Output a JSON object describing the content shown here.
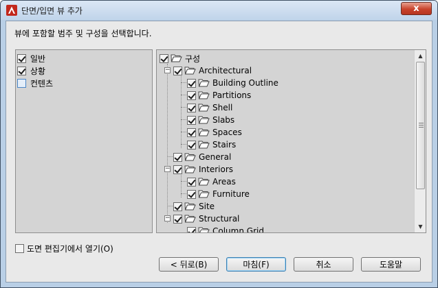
{
  "window": {
    "title": "단면/입면 뷰 추가",
    "close_label": "x"
  },
  "instruction": "뷰에 포함할 범주 및 구성을 선택합니다.",
  "left_list": [
    {
      "label": "일반",
      "checked": true
    },
    {
      "label": "상황",
      "checked": true
    },
    {
      "label": "컨텐츠",
      "checked": false
    }
  ],
  "tree": {
    "root": "구성",
    "architectural": "Architectural",
    "arch_children": [
      "Building Outline",
      "Partitions",
      "Shell",
      "Slabs",
      "Spaces",
      "Stairs"
    ],
    "general": "General",
    "interiors": "Interiors",
    "interior_children": [
      "Areas",
      "Furniture"
    ],
    "site": "Site",
    "structural": "Structural",
    "structural_children": [
      "Column Grid"
    ]
  },
  "bottom_check": {
    "label": "도면 편집기에서 열기(O)",
    "checked": false
  },
  "buttons": {
    "back": "< 뒤로(B)",
    "finish": "마침(F)",
    "cancel": "취소",
    "help": "도움말"
  },
  "colors": {
    "window_border": "#3f4f62",
    "close_red": "#c8432c",
    "panel_bg": "#d4d4d4"
  }
}
